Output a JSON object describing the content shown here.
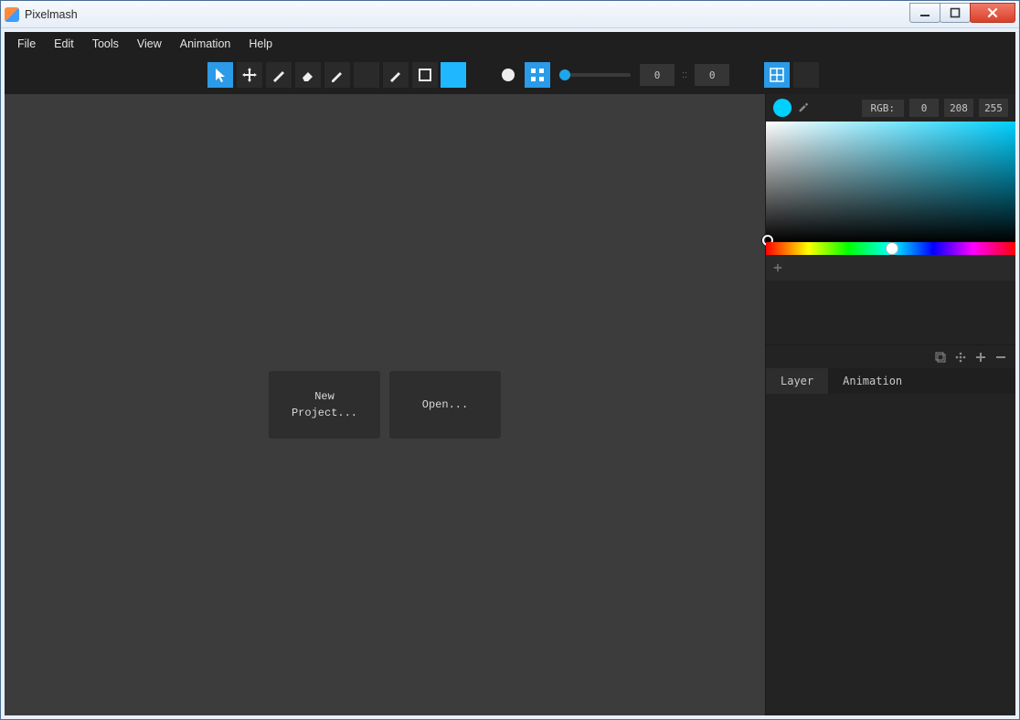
{
  "window": {
    "title": "Pixelmash"
  },
  "menu": {
    "items": [
      "File",
      "Edit",
      "Tools",
      "View",
      "Animation",
      "Help"
    ]
  },
  "toolbar": {
    "size1": "0",
    "size_sep": "::",
    "size2": "0",
    "current_color": "#1fb7ff"
  },
  "canvas": {
    "new_project": "New\nProject...",
    "open": "Open..."
  },
  "color_panel": {
    "mode_label": "RGB:",
    "r": "0",
    "g": "208",
    "b": "255",
    "current": "#00d0ff"
  },
  "panel_tabs": {
    "layer": "Layer",
    "animation": "Animation"
  }
}
